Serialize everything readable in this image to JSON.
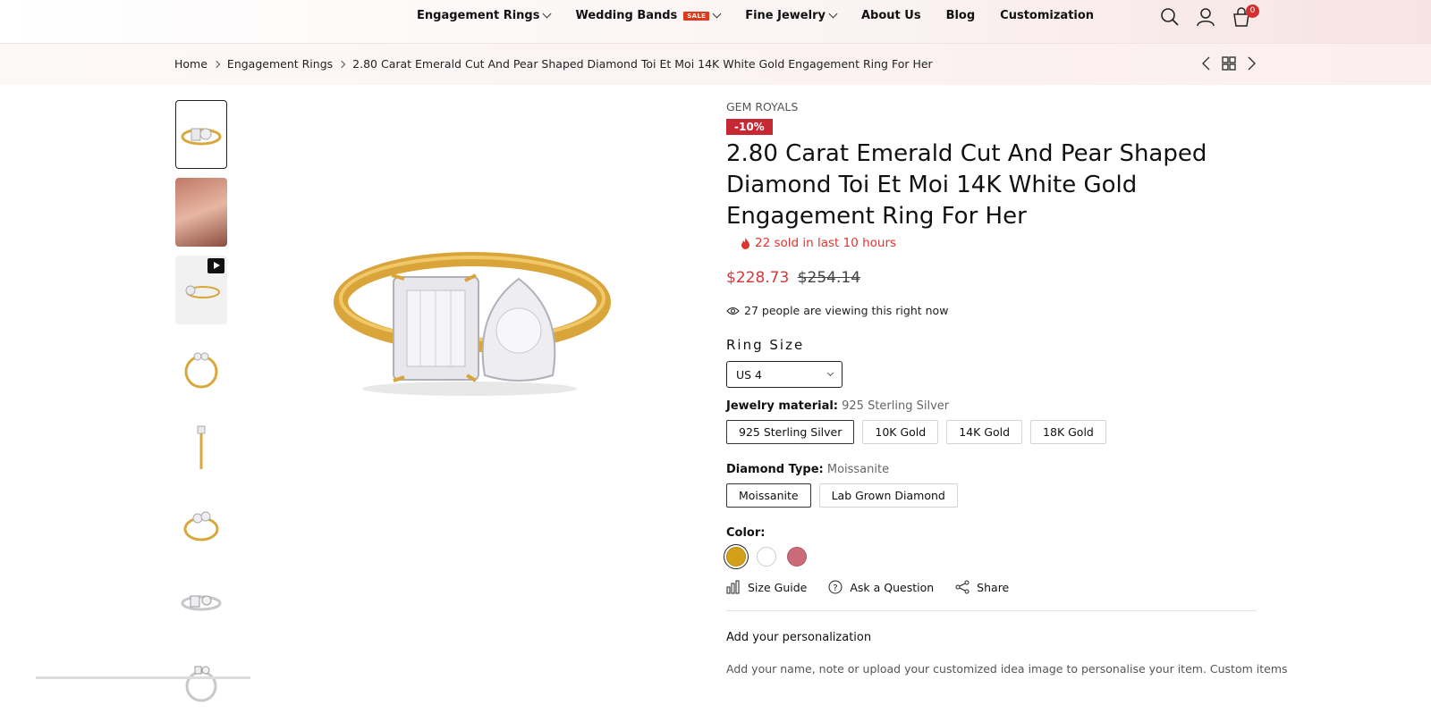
{
  "nav": {
    "items": [
      {
        "label": "Engagement Rings",
        "dropdown": true
      },
      {
        "label": "Wedding Bands",
        "badge": "SALE",
        "dropdown": true
      },
      {
        "label": "Fine Jewelry",
        "dropdown": true
      },
      {
        "label": "About Us",
        "dropdown": false
      },
      {
        "label": "Blog",
        "dropdown": false
      },
      {
        "label": "Customization",
        "dropdown": false
      }
    ],
    "cart_count": "0",
    "icons": [
      "search-icon",
      "account-icon",
      "cart-icon"
    ]
  },
  "breadcrumb": {
    "home": "Home",
    "category": "Engagement Rings",
    "current": "2.80 Carat Emerald Cut And Pear Shaped Diamond Toi Et Moi 14K White Gold Engagement Ring For Her"
  },
  "product": {
    "brand": "GEM ROYALS",
    "discount": "-10%",
    "title": "2.80 Carat Emerald Cut And Pear Shaped Diamond Toi Et Moi 14K White Gold Engagement Ring For Her",
    "sold_text": "22 sold in last 10 hours",
    "price_sale": "$228.73",
    "price_old": "$254.14",
    "viewing_text": "27 people are viewing this right now",
    "ring_size_heading": "Ring Size",
    "ring_size_value": "US 4",
    "material_label": "Jewelry material:",
    "material_value": "925 Sterling Silver",
    "materials": [
      "925 Sterling Silver",
      "10K Gold",
      "14K Gold",
      "18K Gold"
    ],
    "diamond_label": "Diamond Type:",
    "diamond_value": "Moissanite",
    "diamonds": [
      "Moissanite",
      "Lab Grown Diamond"
    ],
    "color_label": "Color:",
    "colors": [
      "#d4a017",
      "#ffffff",
      "#c96b78"
    ],
    "actions": [
      "Size Guide",
      "Ask a Question",
      "Share"
    ],
    "personalization_heading": "Add your personalization",
    "personalization_text": "Add your name, note or upload your customized idea image to personalise your item. Custom items"
  }
}
